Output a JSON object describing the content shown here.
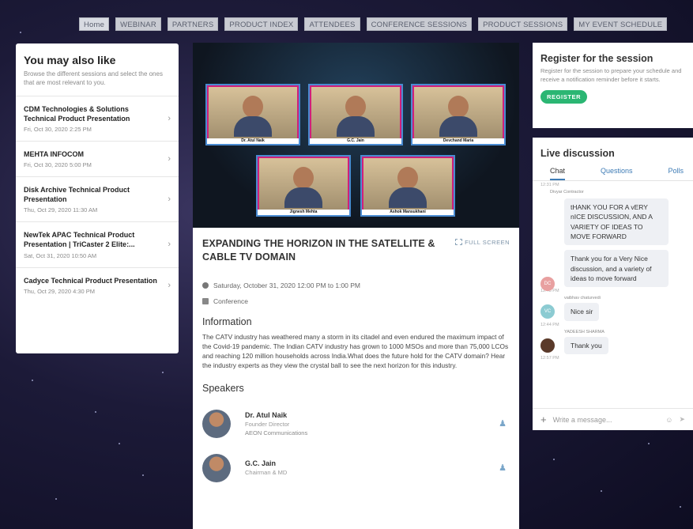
{
  "nav": [
    "Home",
    "WEBINAR",
    "PARTNERS",
    "PRODUCT INDEX",
    "ATTENDEES",
    "CONFERENCE SESSIONS",
    "PRODUCT SESSIONS",
    "MY EVENT SCHEDULE"
  ],
  "left": {
    "title": "You may also like",
    "desc": "Browse the different sessions and select the ones that are most relevant to you.",
    "items": [
      {
        "title": "CDM Technologies & Solutions Technical Product Presentation",
        "date": "Fri, Oct 30, 2020 2:25 PM"
      },
      {
        "title": "MEHTA INFOCOM",
        "date": "Fri, Oct 30, 2020 5:00 PM"
      },
      {
        "title": "Disk Archive Technical Product Presentation",
        "date": "Thu, Oct 29, 2020 11:30 AM"
      },
      {
        "title": "NewTek APAC Technical Product Presentation | TriCaster 2 Elite:...",
        "date": "Sat, Oct 31, 2020 10:50 AM"
      },
      {
        "title": "Cadyce Technical Product Presentation",
        "date": "Thu, Oct 29, 2020 4:30 PM"
      }
    ]
  },
  "video": {
    "participants": [
      "Dr. Atul Naik",
      "G.C. Jain",
      "Devchand Maria",
      "Jignesh Mehta",
      "Ashok Mansukhani"
    ]
  },
  "session": {
    "title": "EXPANDING THE HORIZON IN THE SATELLITE & CABLE TV DOMAIN",
    "fullscreen": "FULL SCREEN",
    "datetime": "Saturday, October 31, 2020 12:00 PM to 1:00 PM",
    "type": "Conference",
    "info_heading": "Information",
    "info": "The CATV industry has weathered many a storm in its citadel and even endured the maximum impact of the Covid-19 pandemic. The Indian CATV industry has grown to 1000 MSOs and more than 75,000 LCOs and reaching 120 million households across India.What does the future hold for the CATV domain? Hear the industry experts as they view the crystal ball to see the next horizon for this industry.",
    "speakers_heading": "Speakers",
    "speakers": [
      {
        "name": "Dr. Atul Naik",
        "role": "Founder Director",
        "company": "AEON Communications"
      },
      {
        "name": "G.C. Jain",
        "role": "Chairman & MD",
        "company": ""
      }
    ]
  },
  "register": {
    "title": "Register for the session",
    "desc": "Register for the session to prepare your schedule and receive a notification reminder before it starts.",
    "button": "REGISTER"
  },
  "live": {
    "title": "Live discussion",
    "tabs": [
      "Chat",
      "Questions",
      "Polls"
    ],
    "messages": [
      {
        "time": "12:31 PM",
        "author": "Divyar Contractor",
        "text": "tHANK YOU FOR A vERY nICE DISCUSSION, AND A VARIETY OF IDEAS TO MOVE FORWARD"
      },
      {
        "time": "",
        "author": "",
        "text": "Thank you for a Very Nice discussion, and a variety of ideas to move forward"
      },
      {
        "time": "12:43 PM",
        "author": "vaibhav chaturvedi",
        "text": "Nice sir"
      },
      {
        "time": "12:44 PM",
        "author": "YADEESH SHARMA",
        "text": "Thank you"
      },
      {
        "time": "12:57 PM",
        "author": "",
        "text": ""
      }
    ],
    "avatars": [
      "DC",
      "VC"
    ],
    "placeholder": "Write a message..."
  }
}
